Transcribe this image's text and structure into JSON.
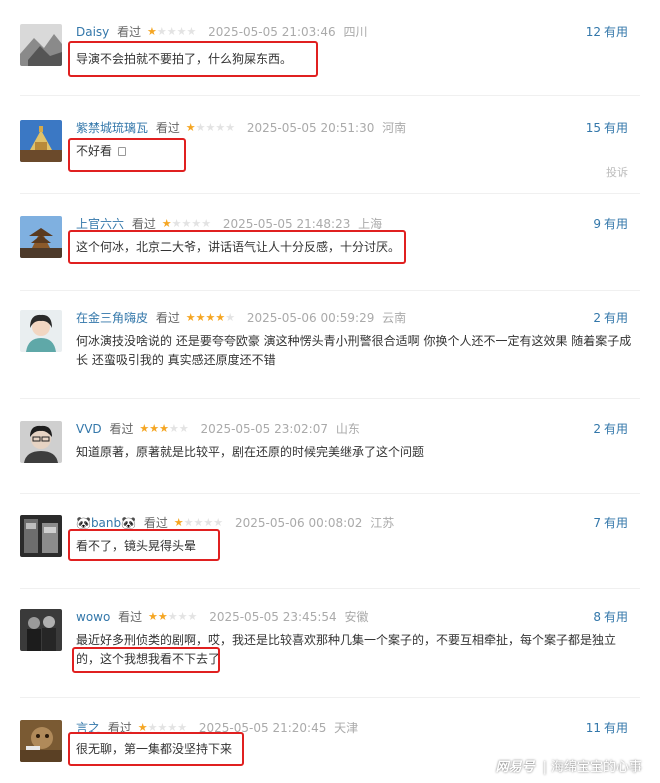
{
  "labels": {
    "watched": "看过",
    "useful": "有用",
    "report": "投诉"
  },
  "comments": [
    {
      "user": "Daisy",
      "stars": 1,
      "time": "2025-05-05 21:03:46",
      "location": "四川",
      "useful": "12",
      "text": "导演不会拍就不要拍了，什么狗屎东西。"
    },
    {
      "user": "紫禁城琉璃瓦",
      "stars": 1,
      "time": "2025-05-05 20:51:30",
      "location": "河南",
      "useful": "15",
      "text": "不好看"
    },
    {
      "user": "上官六六",
      "stars": 1,
      "time": "2025-05-05 21:48:23",
      "location": "上海",
      "useful": "9",
      "text": "这个何冰，北京二大爷，讲话语气让人十分反感，十分讨厌。"
    },
    {
      "user": "在金三角嗨皮",
      "stars": 4,
      "time": "2025-05-06 00:59:29",
      "location": "云南",
      "useful": "2",
      "text": "何冰演技没啥说的 还是要夸夸欧豪 演这种愣头青小刑警很合适啊 你换个人还不一定有这效果 随着案子成长 还蛮吸引我的 真实感还原度还不错"
    },
    {
      "user": "VVD",
      "stars": 3,
      "time": "2025-05-05 23:02:07",
      "location": "山东",
      "useful": "2",
      "text": "知道原著，原著就是比较平，剧在还原的时候完美继承了这个问题"
    },
    {
      "user": "🐼banb🐼",
      "stars": 1,
      "time": "2025-05-06 00:08:02",
      "location": "江苏",
      "useful": "7",
      "text": "看不了，镜头晃得头晕"
    },
    {
      "user": "wowo",
      "stars": 2,
      "time": "2025-05-05 23:45:54",
      "location": "安徽",
      "useful": "8",
      "text": "最近好多刑侦类的剧啊，哎，我还是比较喜欢那种几集一个案子的，不要互相牵扯，每个案子都是独立的，这个我想我看不下去了"
    },
    {
      "user": "言之",
      "stars": 1,
      "time": "2025-05-05 21:20:45",
      "location": "天津",
      "useful": "11",
      "text": "很无聊，第一集都没坚持下来"
    }
  ],
  "watermark": {
    "brand": "网易号",
    "separator": "|",
    "author": "海绵宝宝的心事"
  }
}
